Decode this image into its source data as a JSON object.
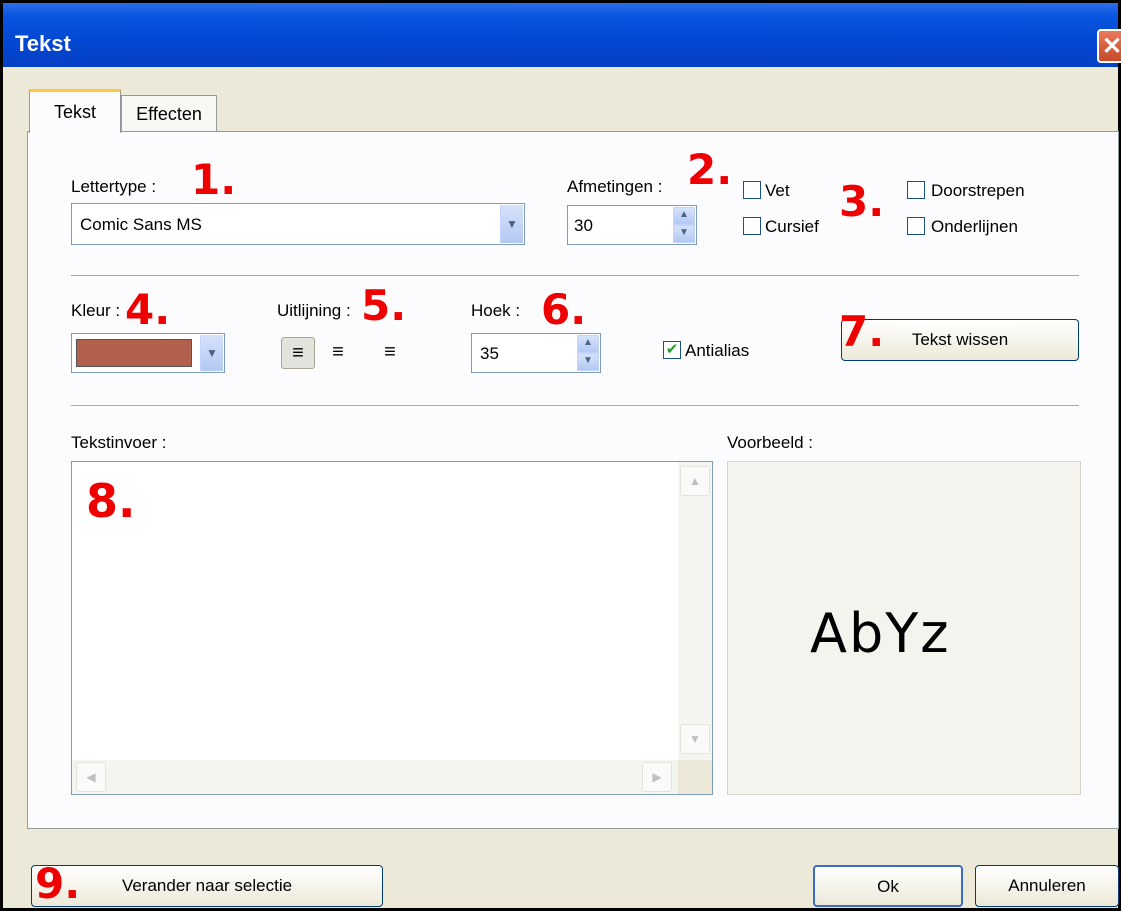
{
  "window": {
    "title": "Tekst",
    "close_glyph": "✕"
  },
  "tabs": [
    {
      "label": "Tekst",
      "active": true
    },
    {
      "label": "Effecten",
      "active": false
    }
  ],
  "font": {
    "label": "Lettertype :",
    "value": "Comic Sans MS",
    "marker": "1."
  },
  "size": {
    "label": "Afmetingen :",
    "value": "30",
    "marker": "2."
  },
  "style": {
    "marker": "3.",
    "bold": {
      "label": "Vet",
      "checked": false
    },
    "italic": {
      "label": "Cursief",
      "checked": false
    },
    "strikethrough": {
      "label": "Doorstrepen",
      "checked": false
    },
    "underline": {
      "label": "Onderlijnen",
      "checked": false
    }
  },
  "color": {
    "label": "Kleur :",
    "value": "#b0604c",
    "marker": "4."
  },
  "alignment": {
    "label": "Uitlijning :",
    "marker": "5.",
    "options": [
      "left",
      "center",
      "right"
    ],
    "selected": "left"
  },
  "angle": {
    "label": "Hoek :",
    "value": "35",
    "marker": "6."
  },
  "antialias": {
    "label": "Antialias",
    "checked": true
  },
  "clear_button": {
    "label": "Tekst wissen",
    "marker": "7."
  },
  "text_input": {
    "label": "Tekstinvoer :",
    "value": "",
    "marker": "8."
  },
  "preview": {
    "label": "Voorbeeld :",
    "sample": "AbYz"
  },
  "footer": {
    "marker": "9.",
    "change_selection_label": "Verander naar selectie",
    "ok_label": "Ok",
    "cancel_label": "Annuleren"
  },
  "colors": {
    "titlebar": "#0a56e0",
    "annotation": "#ee0000",
    "dialog_bg": "#ece9d8"
  }
}
